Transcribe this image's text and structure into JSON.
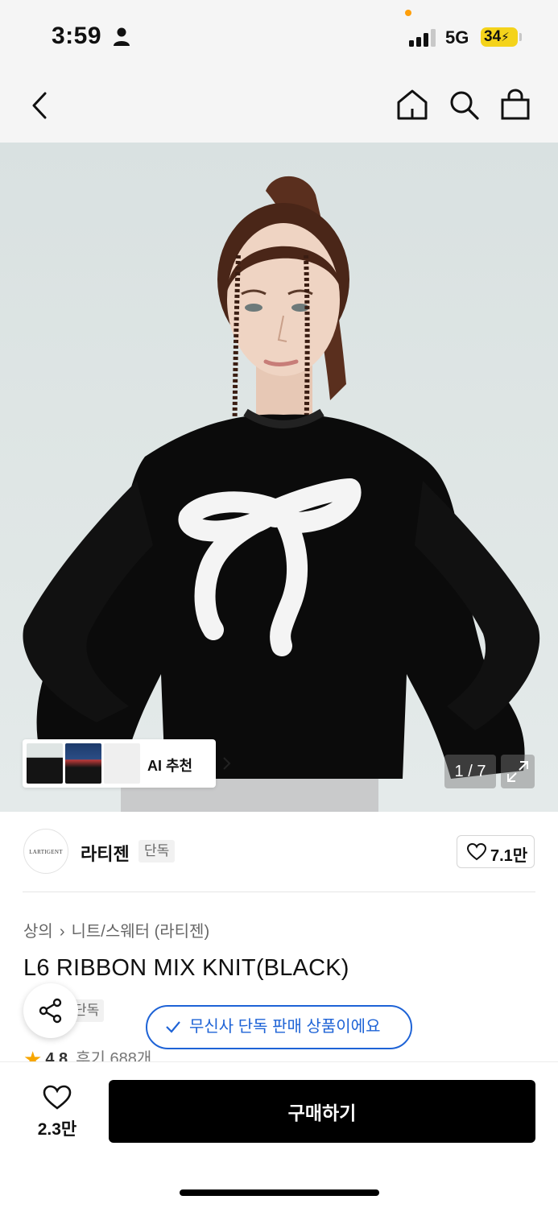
{
  "status_bar": {
    "time": "3:59",
    "network": "5G",
    "battery": "34"
  },
  "nav": {
    "icons": [
      "back-arrow-icon",
      "home-icon",
      "search-icon",
      "shopping-bag-icon"
    ]
  },
  "hero": {
    "ai_recommend_label": "AI 추천",
    "pager": "1 / 7"
  },
  "brand": {
    "logo_text": "LARTIGENT",
    "name": "라티젠",
    "badge": "단독",
    "like_count": "7.1만"
  },
  "product": {
    "breadcrumb": [
      "상의",
      "니트/스웨터 (라티젠)"
    ],
    "title": "L6 RIBBON MIX KNIT(BLACK)",
    "tag_partial": "단독",
    "rating": "4.8",
    "reviews": "후기 688개"
  },
  "toast": {
    "text": "무신사 단독 판매 상품이에요"
  },
  "bottom": {
    "like_count": "2.3만",
    "buy_label": "구매하기"
  },
  "colors": {
    "accent_blue": "#1e63d6",
    "star": "#f7a600",
    "battery": "#f4d31b",
    "buy_button": "#000000"
  }
}
